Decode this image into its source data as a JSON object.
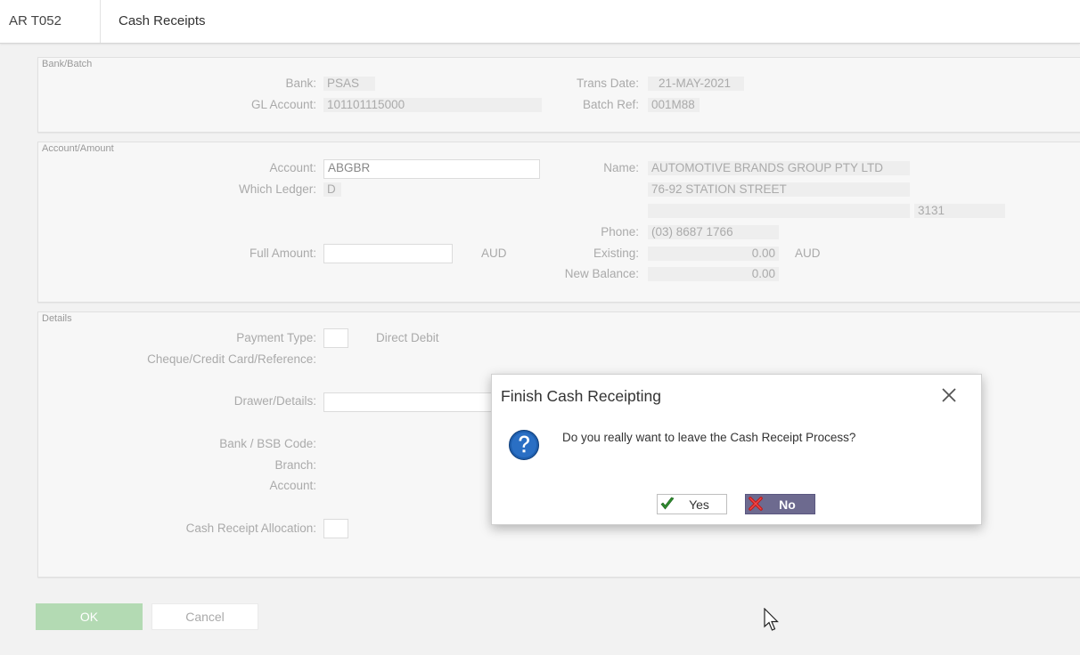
{
  "header": {
    "code": "AR T052",
    "title": "Cash Receipts"
  },
  "bank_batch": {
    "legend": "Bank/Batch",
    "bank_label": "Bank:",
    "bank_value": "PSAS",
    "gl_label": "GL Account:",
    "gl_value": "101101115000",
    "trans_date_label": "Trans Date:",
    "trans_date_value": "21-MAY-2021",
    "batch_ref_label": "Batch Ref:",
    "batch_ref_value": "001M88"
  },
  "account_amount": {
    "legend": "Account/Amount",
    "account_label": "Account:",
    "account_value": "ABGBR",
    "ledger_label": "Which Ledger:",
    "ledger_value": "D",
    "full_amount_label": "Full Amount:",
    "full_amount_value": "",
    "full_amount_currency": "AUD",
    "name_label": "Name:",
    "name_value": "AUTOMOTIVE BRANDS GROUP PTY LTD",
    "address_line1": "76-92 STATION STREET",
    "address_line2": "",
    "postcode": "3131",
    "phone_label": "Phone:",
    "phone_value": "(03) 8687 1766",
    "existing_label": "Existing:",
    "existing_value": "0.00",
    "existing_currency": "AUD",
    "new_balance_label": "New Balance:",
    "new_balance_value": "0.00"
  },
  "details": {
    "legend": "Details",
    "payment_type_label": "Payment Type:",
    "payment_type_value": "",
    "payment_type_desc": "Direct Debit",
    "cheque_label": "Cheque/Credit Card/Reference:",
    "drawer_label": "Drawer/Details:",
    "drawer_value": "",
    "bsb_label": "Bank / BSB Code:",
    "branch_label": "Branch:",
    "account_label": "Account:",
    "allocation_label": "Cash Receipt Allocation:",
    "allocation_value": ""
  },
  "footer": {
    "ok_label": "OK",
    "cancel_label": "Cancel"
  },
  "dialog": {
    "title": "Finish Cash Receipting",
    "message": "Do you really want to leave the Cash Receipt Process?",
    "yes_label": "Yes",
    "no_label": "No",
    "icon": "question-icon"
  }
}
